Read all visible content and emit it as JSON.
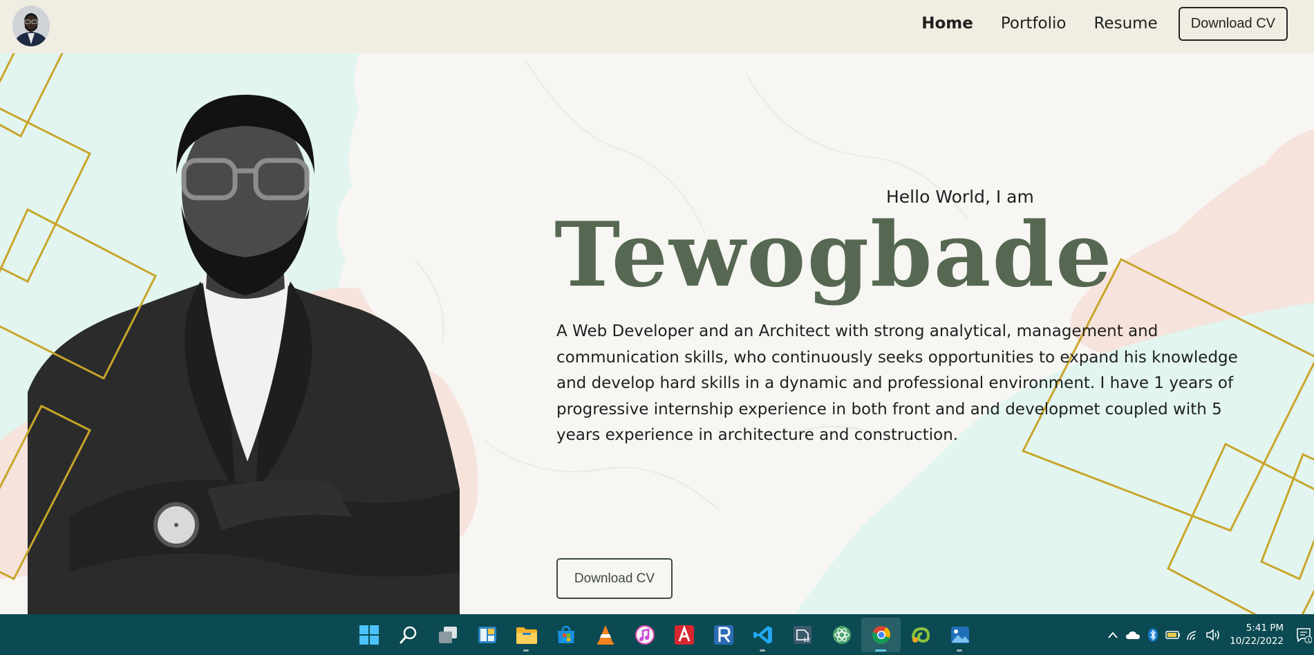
{
  "nav": {
    "links": [
      {
        "label": "Home",
        "active": true
      },
      {
        "label": "Portfolio",
        "active": false
      },
      {
        "label": "Resume",
        "active": false
      }
    ],
    "cta_label": "Download CV"
  },
  "hero": {
    "greeting": "Hello World, I am",
    "name": "Tewogbade",
    "bio": "A Web Developer and an Architect with strong analytical, management and communication skills, who continuously seeks opportunities to expand his knowledge and develop hard skills in a dynamic and professional environment. I have 1 years of progressive internship experience in both front and and developmet coupled with 5 years experience in architecture and construction.",
    "cta_label": "Download CV",
    "name_color": "#566851",
    "accent_gold": "#c8a52a",
    "blob_mint": "#e2f5f0",
    "blob_pink": "#f6e3dc"
  },
  "taskbar": {
    "color": "#0b4a52",
    "apps": [
      {
        "icon": "windows-start-icon"
      },
      {
        "icon": "search-icon"
      },
      {
        "icon": "task-view-icon"
      },
      {
        "icon": "widgets-icon"
      },
      {
        "icon": "file-explorer-icon"
      },
      {
        "icon": "microsoft-store-icon"
      },
      {
        "icon": "vlc-icon"
      },
      {
        "icon": "itunes-icon"
      },
      {
        "icon": "autocad-icon"
      },
      {
        "icon": "revit-icon"
      },
      {
        "icon": "vscode-icon"
      },
      {
        "icon": "sketchup-icon"
      },
      {
        "icon": "atom-icon"
      },
      {
        "icon": "chrome-icon"
      },
      {
        "icon": "chameleon-app-icon"
      },
      {
        "icon": "photos-icon"
      }
    ],
    "clock": {
      "time": "5:41 PM",
      "date": "10/22/2022"
    },
    "notification_count": "1"
  }
}
